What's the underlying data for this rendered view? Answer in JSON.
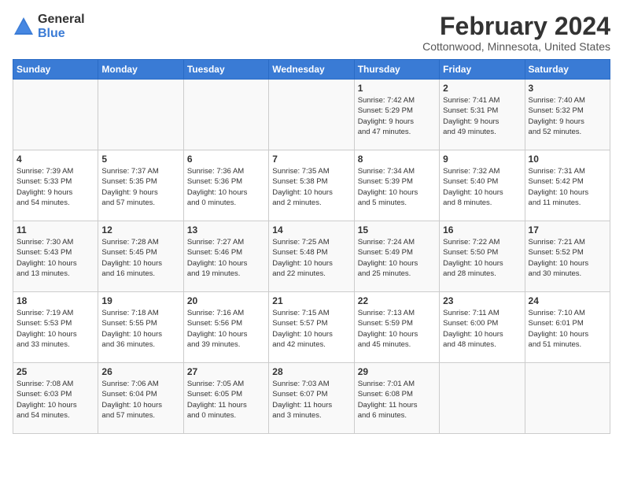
{
  "header": {
    "logo_general": "General",
    "logo_blue": "Blue",
    "title": "February 2024",
    "subtitle": "Cottonwood, Minnesota, United States"
  },
  "weekdays": [
    "Sunday",
    "Monday",
    "Tuesday",
    "Wednesday",
    "Thursday",
    "Friday",
    "Saturday"
  ],
  "weeks": [
    [
      {
        "day": "",
        "info": ""
      },
      {
        "day": "",
        "info": ""
      },
      {
        "day": "",
        "info": ""
      },
      {
        "day": "",
        "info": ""
      },
      {
        "day": "1",
        "info": "Sunrise: 7:42 AM\nSunset: 5:29 PM\nDaylight: 9 hours\nand 47 minutes."
      },
      {
        "day": "2",
        "info": "Sunrise: 7:41 AM\nSunset: 5:31 PM\nDaylight: 9 hours\nand 49 minutes."
      },
      {
        "day": "3",
        "info": "Sunrise: 7:40 AM\nSunset: 5:32 PM\nDaylight: 9 hours\nand 52 minutes."
      }
    ],
    [
      {
        "day": "4",
        "info": "Sunrise: 7:39 AM\nSunset: 5:33 PM\nDaylight: 9 hours\nand 54 minutes."
      },
      {
        "day": "5",
        "info": "Sunrise: 7:37 AM\nSunset: 5:35 PM\nDaylight: 9 hours\nand 57 minutes."
      },
      {
        "day": "6",
        "info": "Sunrise: 7:36 AM\nSunset: 5:36 PM\nDaylight: 10 hours\nand 0 minutes."
      },
      {
        "day": "7",
        "info": "Sunrise: 7:35 AM\nSunset: 5:38 PM\nDaylight: 10 hours\nand 2 minutes."
      },
      {
        "day": "8",
        "info": "Sunrise: 7:34 AM\nSunset: 5:39 PM\nDaylight: 10 hours\nand 5 minutes."
      },
      {
        "day": "9",
        "info": "Sunrise: 7:32 AM\nSunset: 5:40 PM\nDaylight: 10 hours\nand 8 minutes."
      },
      {
        "day": "10",
        "info": "Sunrise: 7:31 AM\nSunset: 5:42 PM\nDaylight: 10 hours\nand 11 minutes."
      }
    ],
    [
      {
        "day": "11",
        "info": "Sunrise: 7:30 AM\nSunset: 5:43 PM\nDaylight: 10 hours\nand 13 minutes."
      },
      {
        "day": "12",
        "info": "Sunrise: 7:28 AM\nSunset: 5:45 PM\nDaylight: 10 hours\nand 16 minutes."
      },
      {
        "day": "13",
        "info": "Sunrise: 7:27 AM\nSunset: 5:46 PM\nDaylight: 10 hours\nand 19 minutes."
      },
      {
        "day": "14",
        "info": "Sunrise: 7:25 AM\nSunset: 5:48 PM\nDaylight: 10 hours\nand 22 minutes."
      },
      {
        "day": "15",
        "info": "Sunrise: 7:24 AM\nSunset: 5:49 PM\nDaylight: 10 hours\nand 25 minutes."
      },
      {
        "day": "16",
        "info": "Sunrise: 7:22 AM\nSunset: 5:50 PM\nDaylight: 10 hours\nand 28 minutes."
      },
      {
        "day": "17",
        "info": "Sunrise: 7:21 AM\nSunset: 5:52 PM\nDaylight: 10 hours\nand 30 minutes."
      }
    ],
    [
      {
        "day": "18",
        "info": "Sunrise: 7:19 AM\nSunset: 5:53 PM\nDaylight: 10 hours\nand 33 minutes."
      },
      {
        "day": "19",
        "info": "Sunrise: 7:18 AM\nSunset: 5:55 PM\nDaylight: 10 hours\nand 36 minutes."
      },
      {
        "day": "20",
        "info": "Sunrise: 7:16 AM\nSunset: 5:56 PM\nDaylight: 10 hours\nand 39 minutes."
      },
      {
        "day": "21",
        "info": "Sunrise: 7:15 AM\nSunset: 5:57 PM\nDaylight: 10 hours\nand 42 minutes."
      },
      {
        "day": "22",
        "info": "Sunrise: 7:13 AM\nSunset: 5:59 PM\nDaylight: 10 hours\nand 45 minutes."
      },
      {
        "day": "23",
        "info": "Sunrise: 7:11 AM\nSunset: 6:00 PM\nDaylight: 10 hours\nand 48 minutes."
      },
      {
        "day": "24",
        "info": "Sunrise: 7:10 AM\nSunset: 6:01 PM\nDaylight: 10 hours\nand 51 minutes."
      }
    ],
    [
      {
        "day": "25",
        "info": "Sunrise: 7:08 AM\nSunset: 6:03 PM\nDaylight: 10 hours\nand 54 minutes."
      },
      {
        "day": "26",
        "info": "Sunrise: 7:06 AM\nSunset: 6:04 PM\nDaylight: 10 hours\nand 57 minutes."
      },
      {
        "day": "27",
        "info": "Sunrise: 7:05 AM\nSunset: 6:05 PM\nDaylight: 11 hours\nand 0 minutes."
      },
      {
        "day": "28",
        "info": "Sunrise: 7:03 AM\nSunset: 6:07 PM\nDaylight: 11 hours\nand 3 minutes."
      },
      {
        "day": "29",
        "info": "Sunrise: 7:01 AM\nSunset: 6:08 PM\nDaylight: 11 hours\nand 6 minutes."
      },
      {
        "day": "",
        "info": ""
      },
      {
        "day": "",
        "info": ""
      }
    ]
  ]
}
